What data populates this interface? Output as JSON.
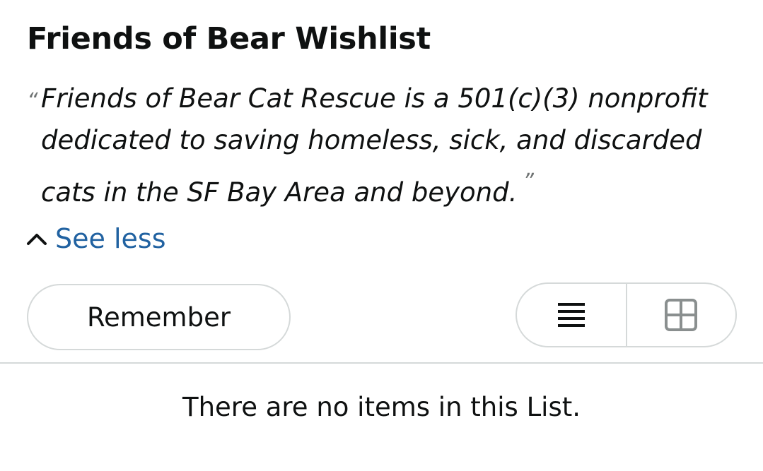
{
  "list": {
    "title": "Friends of Bear Wishlist",
    "description": "Friends of Bear Cat Rescue is a 501(c)(3) nonprofit dedicated to saving homeless, sick, and discarded cats in the SF Bay Area and beyond.",
    "quote_open": "“",
    "quote_close": "”"
  },
  "see_less": {
    "label": "See less",
    "icon": "chevron-up-icon",
    "color": "#2162a1"
  },
  "remember_button": {
    "label": "Remember"
  },
  "view_toggle": {
    "options": [
      {
        "name": "list-view",
        "icon": "list-view-icon"
      },
      {
        "name": "grid-view",
        "icon": "grid-view-icon"
      }
    ]
  },
  "empty_state": {
    "message": "There are no items in this List."
  }
}
